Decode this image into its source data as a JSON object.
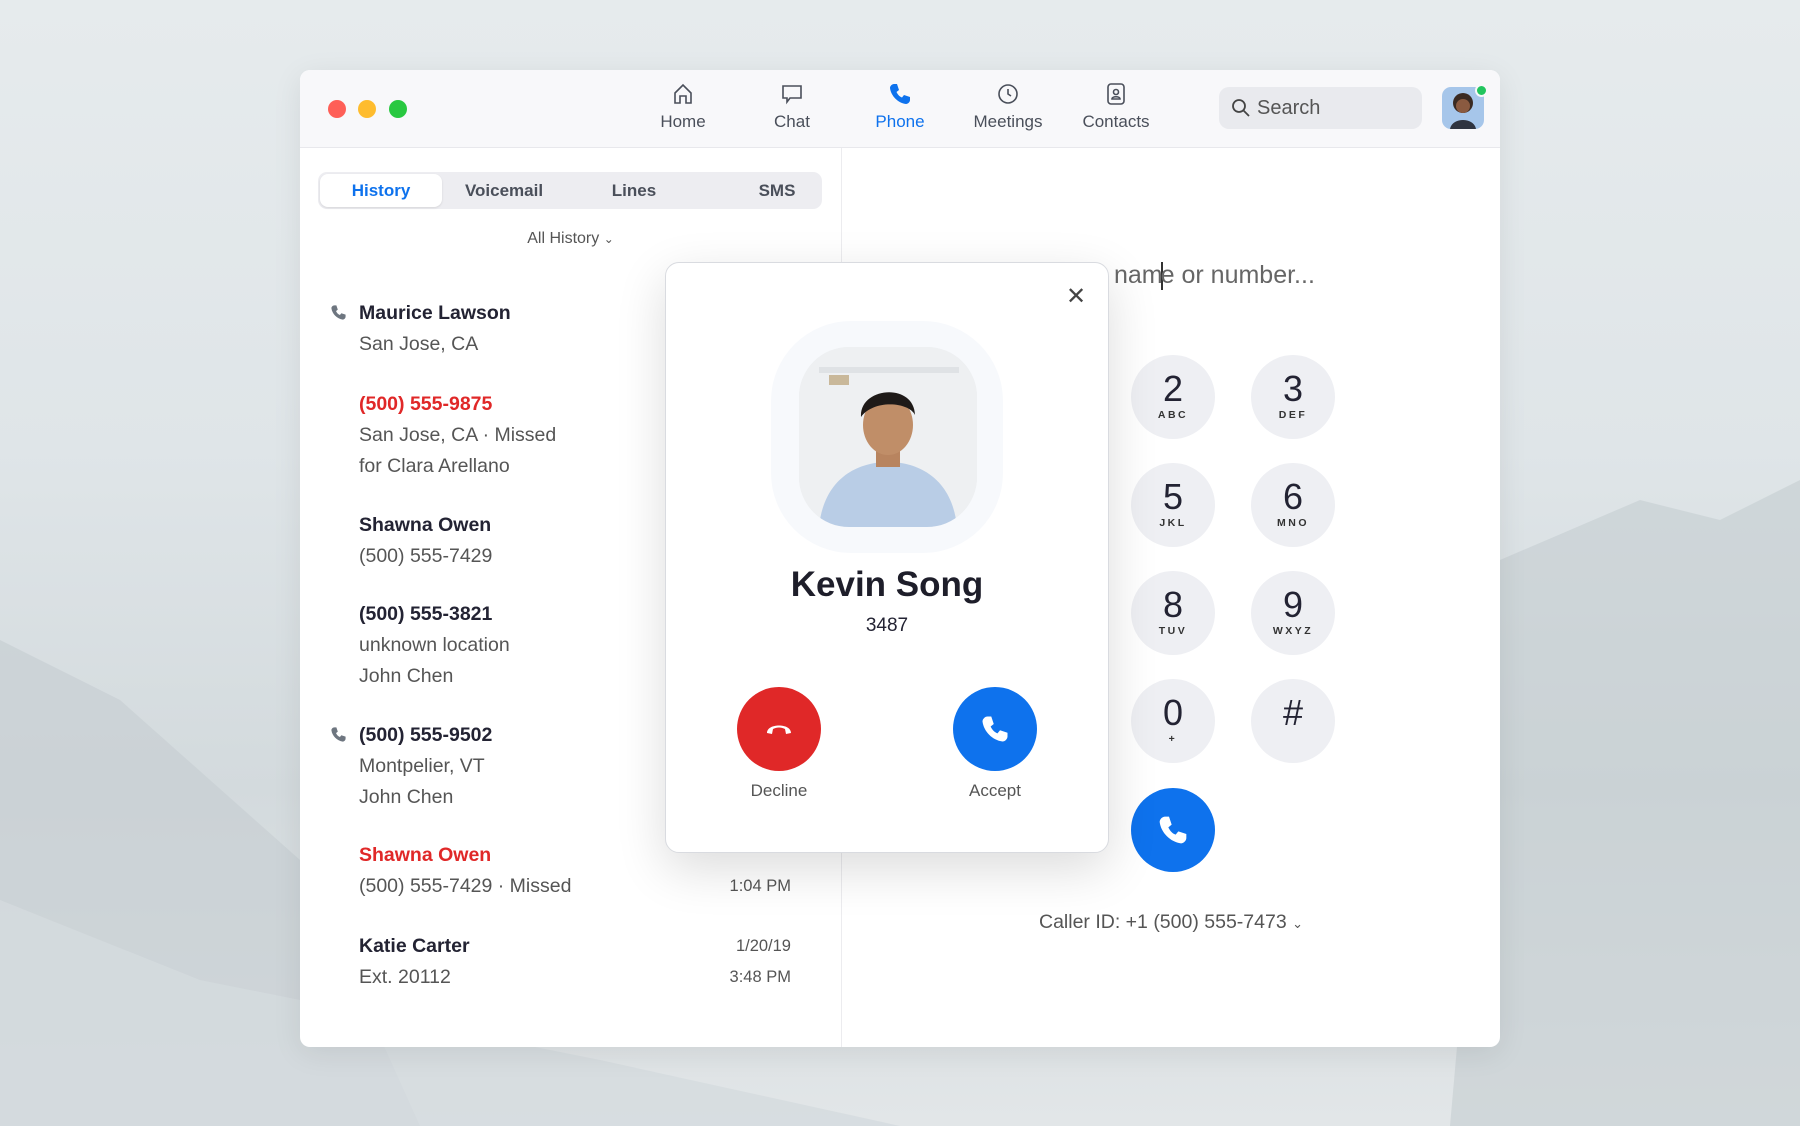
{
  "nav": {
    "items": [
      {
        "label": "Home",
        "icon": "home-icon"
      },
      {
        "label": "Chat",
        "icon": "chat-icon"
      },
      {
        "label": "Phone",
        "icon": "phone-icon",
        "active": true
      },
      {
        "label": "Meetings",
        "icon": "clock-icon"
      },
      {
        "label": "Contacts",
        "icon": "contacts-icon"
      }
    ],
    "search_placeholder": "Search"
  },
  "tabs": [
    "History",
    "Voicemail",
    "Lines",
    "SMS"
  ],
  "filter": "All History",
  "history": [
    {
      "name": "Maurice Lawson",
      "lines": [
        "San Jose, CA"
      ],
      "icon": true,
      "missed": false
    },
    {
      "name": "(500) 555-9875",
      "lines": [
        "San Jose, CA · Missed",
        "for Clara Arellano"
      ],
      "missed": true
    },
    {
      "name": "Shawna Owen",
      "lines": [
        "(500) 555-7429"
      ],
      "missed": false
    },
    {
      "name": "(500) 555-3821",
      "lines": [
        "unknown location",
        "John Chen"
      ],
      "missed": false
    },
    {
      "name": "(500) 555-9502",
      "lines": [
        "Montpelier, VT",
        "John Chen"
      ],
      "icon": true,
      "missed": false
    },
    {
      "name": "Shawna Owen",
      "lines": [
        "(500) 555-7429 · Missed"
      ],
      "missed": true,
      "time": "1:04 PM"
    },
    {
      "name": "Katie Carter",
      "lines": [
        "Ext. 20112"
      ],
      "missed": false,
      "date": "1/20/19",
      "time": "3:48 PM"
    }
  ],
  "dialer": {
    "input_text": "name or number...",
    "keys": [
      {
        "d": "2",
        "l": "ABC"
      },
      {
        "d": "3",
        "l": "DEF"
      },
      {
        "d": "5",
        "l": "JKL"
      },
      {
        "d": "6",
        "l": "MNO"
      },
      {
        "d": "8",
        "l": "TUV"
      },
      {
        "d": "9",
        "l": "WXYZ"
      },
      {
        "d": "0",
        "l": "+"
      },
      {
        "d": "#",
        "l": ""
      }
    ],
    "caller_id": "Caller ID: +1 (500) 555-7473"
  },
  "incoming": {
    "name": "Kevin Song",
    "ext": "3487",
    "decline": "Decline",
    "accept": "Accept"
  },
  "colors": {
    "accent": "#0e72ed",
    "decline": "#e02828",
    "missed": "#e02828"
  }
}
